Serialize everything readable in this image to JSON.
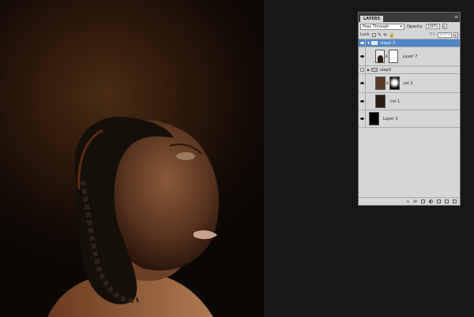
{
  "panel": {
    "tab_label": "LAYERS",
    "menu_icon": "≡",
    "blend_mode": "Pass Through",
    "opacity_label": "Opacity:",
    "opacity_value": "100%",
    "lock_label": "Lock:",
    "fill_label": "Fill:",
    "fill_value": "100%"
  },
  "layers": [
    {
      "name": "step2-3",
      "selected": true,
      "visible": true,
      "kind": "group-open"
    },
    {
      "name": "Layer 7",
      "selected": false,
      "visible": true,
      "kind": "masked"
    },
    {
      "name": "step3",
      "selected": false,
      "visible": false,
      "kind": "group-closed"
    },
    {
      "name": "col 2",
      "selected": false,
      "visible": true,
      "kind": "color-masked"
    },
    {
      "name": "col 1",
      "selected": false,
      "visible": true,
      "kind": "color"
    },
    {
      "name": "Layer 2",
      "selected": false,
      "visible": true,
      "kind": "black"
    }
  ],
  "bottom_icons": [
    "link-icon",
    "fx-icon",
    "mask-icon",
    "adjustment-icon",
    "folder-icon",
    "new-layer-icon",
    "trash-icon"
  ],
  "bottom_text": {
    "link": "∞",
    "fx": "fx"
  },
  "colors": {
    "selection": "#4f86c6",
    "col2_swatch": "#5a3a24",
    "col1_swatch": "#2a1d14"
  }
}
